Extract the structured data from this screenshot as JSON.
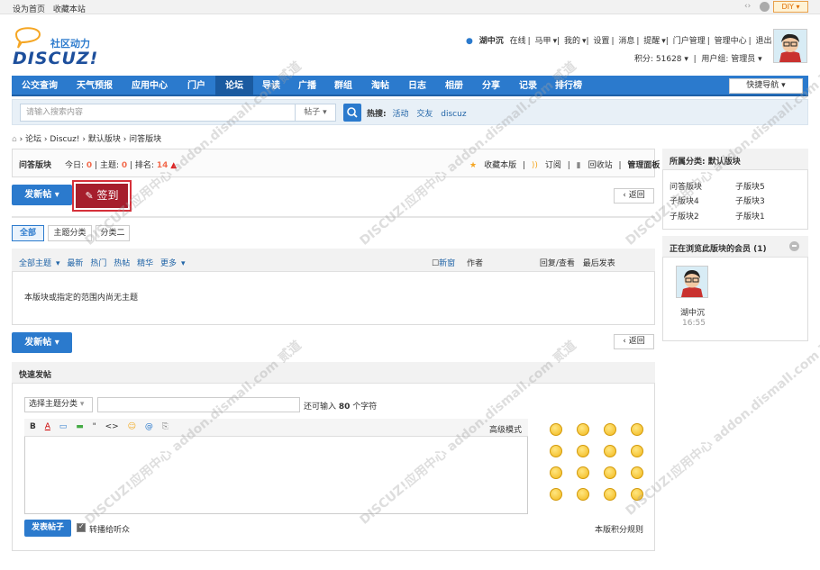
{
  "topbar": {
    "set_home": "设为首页",
    "bookmark": "收藏本站",
    "diy": "DIY"
  },
  "logo": {
    "tagline": "社区动力",
    "brand": "DISCUZ!"
  },
  "header": {
    "username": "湖中沉",
    "status": "在线",
    "user_menu1": "马甲",
    "user_menu2": "我的",
    "settings": "设置",
    "messages": "消息",
    "reminders": "提醒",
    "portal_admin": "门户管理",
    "admin_center": "管理中心",
    "logout": "退出",
    "credits": "积分: 51628",
    "group": "用户组: 管理员"
  },
  "nav": {
    "items": [
      "公交查询",
      "天气预报",
      "应用中心",
      "门户",
      "论坛",
      "导读",
      "广播",
      "群组",
      "淘帖",
      "日志",
      "相册",
      "分享",
      "记录",
      "排行榜"
    ],
    "active": "论坛",
    "quick": "快捷导航"
  },
  "search": {
    "placeholder": "请输入搜索内容",
    "type": "帖子",
    "hot_label": "热搜:",
    "hot": [
      "活动",
      "交友",
      "discuz"
    ]
  },
  "breadcrumb": [
    "论坛",
    "Discuz!",
    "默认版块",
    "问答版块"
  ],
  "forum": {
    "name": "问答版块",
    "today_label": "今日:",
    "today": "0",
    "topics_label": "主题:",
    "topics": "0",
    "rank_label": "排名:",
    "rank": "14",
    "favorite": "收藏本版",
    "subscribe": "订阅",
    "recycle": "回收站",
    "manage": "管理面板"
  },
  "actions": {
    "new_post": "发新帖",
    "signin": "签到",
    "back": "返回"
  },
  "tabs": [
    "全部",
    "主题分类",
    "分类二"
  ],
  "list": {
    "filters": [
      "全部主题",
      "最新",
      "热门",
      "热帖",
      "精华",
      "更多"
    ],
    "new_window": "新窗",
    "author": "作者",
    "replies": "回复/查看",
    "last_post": "最后发表",
    "empty": "本版块或指定的范围内尚无主题"
  },
  "quickpost": {
    "title": "快速发帖",
    "category_placeholder": "选择主题分类",
    "char_hint_prefix": "还可输入",
    "char_count": "80",
    "char_hint_suffix": "个字符",
    "advanced": "高级模式",
    "submit": "发表帖子",
    "repost": "转播给听众",
    "rules": "本版积分规则",
    "tools": [
      "B",
      "A",
      "▭",
      "▬",
      "\"",
      "<>",
      "☺",
      "@",
      "⎘"
    ]
  },
  "sidebar": {
    "category_title": "所属分类: 默认版块",
    "subforums": [
      "问答版块",
      "子版块5",
      "子版块4",
      "子版块3",
      "子版块2",
      "子版块1"
    ],
    "online_title": "正在浏览此版块的会员 (1)",
    "online_user": "湖中沉",
    "online_time": "16:55"
  },
  "watermark": "DISCUZ!应用中心 addon.dismall.com 贰道",
  "colors": {
    "nav": "#2b7acd",
    "signin": "#a61e2c",
    "accent": "#f26c4f"
  }
}
